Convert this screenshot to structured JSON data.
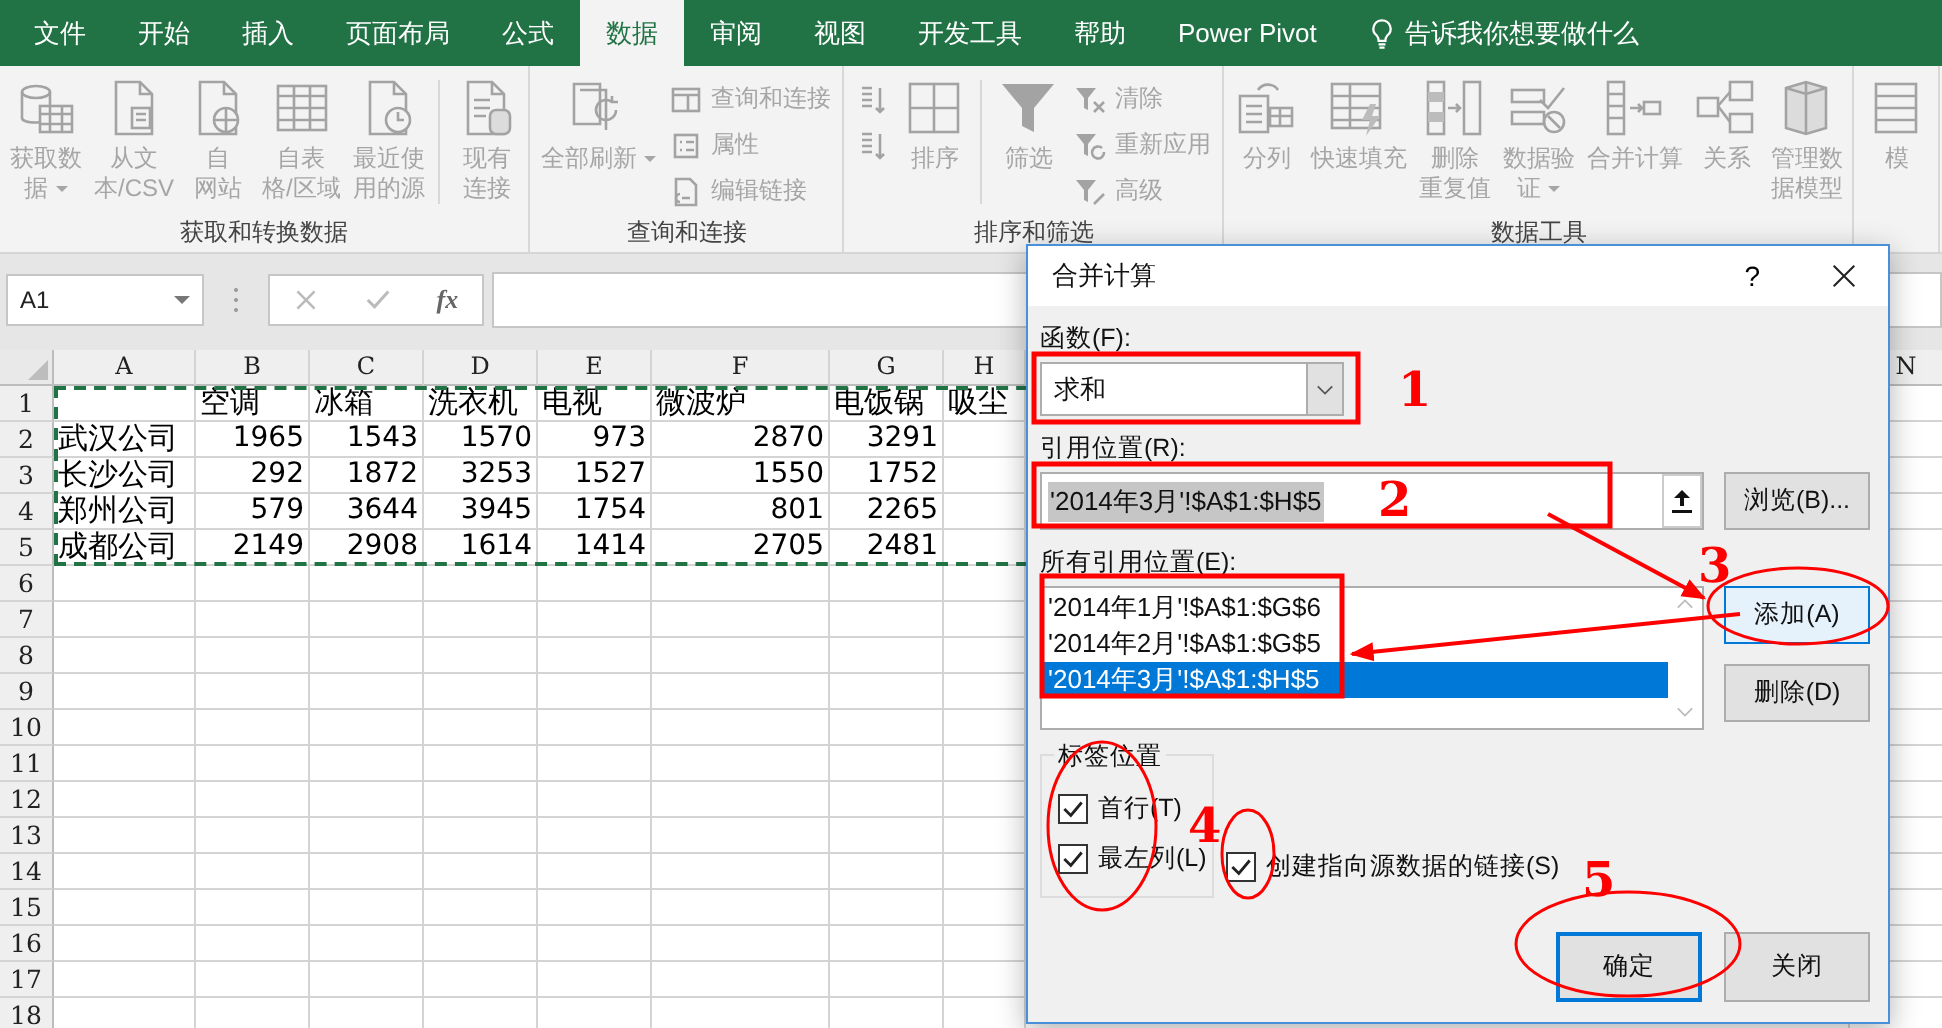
{
  "tabs": [
    {
      "label": "文件",
      "selected": false
    },
    {
      "label": "开始",
      "selected": false
    },
    {
      "label": "插入",
      "selected": false
    },
    {
      "label": "页面布局",
      "selected": false
    },
    {
      "label": "公式",
      "selected": false
    },
    {
      "label": "数据",
      "selected": true
    },
    {
      "label": "审阅",
      "selected": false
    },
    {
      "label": "视图",
      "selected": false
    },
    {
      "label": "开发工具",
      "selected": false
    },
    {
      "label": "帮助",
      "selected": false
    },
    {
      "label": "Power Pivot",
      "selected": false
    }
  ],
  "tell_me": "告诉我你想要做什么",
  "ribbon": {
    "groups": [
      {
        "label": "获取和转换数据",
        "items": [
          {
            "kind": "large",
            "lines": [
              "获取数",
              "据"
            ],
            "dropdown": true
          },
          {
            "kind": "large",
            "lines": [
              "从文",
              "本/CSV"
            ]
          },
          {
            "kind": "large",
            "lines": [
              "自",
              "网站"
            ]
          },
          {
            "kind": "large",
            "lines": [
              "自表",
              "格/区域"
            ]
          },
          {
            "kind": "large",
            "lines": [
              "最近使",
              "用的源"
            ]
          },
          {
            "kind": "separator"
          },
          {
            "kind": "large",
            "lines": [
              "现有",
              "连接"
            ]
          }
        ]
      },
      {
        "label": "查询和连接",
        "items": [
          {
            "kind": "large",
            "lines": [
              "全部刷新"
            ],
            "dropdown": true
          },
          {
            "kind": "stack",
            "buttons": [
              {
                "label": "查询和连接"
              },
              {
                "label": "属性"
              },
              {
                "label": "编辑链接"
              }
            ]
          }
        ]
      },
      {
        "label": "排序和筛选",
        "items": [
          {
            "kind": "stack",
            "buttons": [
              {
                "kind": "icon"
              },
              {
                "kind": "icon"
              }
            ]
          },
          {
            "kind": "large",
            "lines": [
              "排序"
            ]
          },
          {
            "kind": "separator"
          },
          {
            "kind": "large",
            "lines": [
              "筛选"
            ]
          },
          {
            "kind": "stack",
            "buttons": [
              {
                "label": "清除"
              },
              {
                "label": "重新应用"
              },
              {
                "label": "高级"
              }
            ]
          }
        ]
      },
      {
        "label": "数据工具",
        "items": [
          {
            "kind": "large",
            "lines": [
              "分列"
            ]
          },
          {
            "kind": "large",
            "lines": [
              "快速填充"
            ]
          },
          {
            "kind": "large",
            "lines": [
              "删除",
              "重复值"
            ]
          },
          {
            "kind": "large",
            "lines": [
              "数据验",
              "证"
            ],
            "dropdown": true
          },
          {
            "kind": "large",
            "lines": [
              "合并计算"
            ]
          },
          {
            "kind": "large",
            "lines": [
              "关系"
            ]
          },
          {
            "kind": "large",
            "lines": [
              "管理数",
              "据模型"
            ]
          }
        ]
      },
      {
        "items": [
          {
            "kind": "large",
            "lines": [
              "模"
            ]
          }
        ]
      }
    ]
  },
  "formula_bar": {
    "name_box": "A1",
    "function_label": "fx"
  },
  "sheet": {
    "columns": [
      "A",
      "B",
      "C",
      "D",
      "E",
      "F",
      "G",
      "H"
    ],
    "right_columns": [
      "N"
    ],
    "copy_marquee": true,
    "rows": [
      {
        "number": "1",
        "cells": [
          null,
          "空调",
          "冰箱",
          "洗衣机",
          "电视",
          "微波炉",
          "电饭锅",
          "吸尘"
        ]
      },
      {
        "number": "2",
        "cells": [
          "武汉公司",
          "1965",
          "1543",
          "1570",
          "973",
          "2870",
          "3291",
          null
        ]
      },
      {
        "number": "3",
        "cells": [
          "长沙公司",
          "292",
          "1872",
          "3253",
          "1527",
          "1550",
          "1752",
          null
        ]
      },
      {
        "number": "4",
        "cells": [
          "郑州公司",
          "579",
          "3644",
          "3945",
          "1754",
          "801",
          "2265",
          null
        ]
      },
      {
        "number": "5",
        "cells": [
          "成都公司",
          "2149",
          "2908",
          "1614",
          "1414",
          "2705",
          "2481",
          null
        ]
      },
      {
        "number": "6"
      },
      {
        "number": "7"
      },
      {
        "number": "8"
      },
      {
        "number": "9"
      },
      {
        "number": "10"
      },
      {
        "number": "11"
      },
      {
        "number": "12"
      },
      {
        "number": "13"
      },
      {
        "number": "14"
      },
      {
        "number": "15"
      },
      {
        "number": "16"
      },
      {
        "number": "17"
      },
      {
        "number": "18"
      }
    ]
  },
  "dialog": {
    "title": "合并计算",
    "help_button": "?",
    "function_label": "函数(F):",
    "function_value": "求和",
    "reference_label": "引用位置(R):",
    "reference_value": "'2014年3月'!$A$1:$H$5",
    "reference_selected": true,
    "browse_button": {
      "label": "浏览(B)..."
    },
    "all_references_label": "所有引用位置(E):",
    "references": [
      {
        "text": "'2014年1月'!$A$1:$G$6",
        "selected": false
      },
      {
        "text": "'2014年2月'!$A$1:$G$5",
        "selected": false
      },
      {
        "text": "'2014年3月'!$A$1:$H$5",
        "selected": true
      }
    ],
    "add_button": {
      "label": "添加(A)",
      "hovered": true
    },
    "delete_button": {
      "label": "删除(D)",
      "hovered": false
    },
    "label_position": {
      "title": "标签位置",
      "checkboxes": [
        {
          "label": "首行(T)",
          "checked": true
        },
        {
          "label": "最左列(L)",
          "checked": true
        }
      ]
    },
    "link_checkbox": {
      "label": "创建指向源数据的链接(S)",
      "checked": true
    },
    "ok_button": {
      "label": "确定",
      "focused": true
    },
    "close_button": {
      "label": "关闭",
      "focused": false
    }
  },
  "annotations": {
    "step_numbers": [
      "1",
      "2",
      "3",
      "4",
      "5"
    ]
  }
}
